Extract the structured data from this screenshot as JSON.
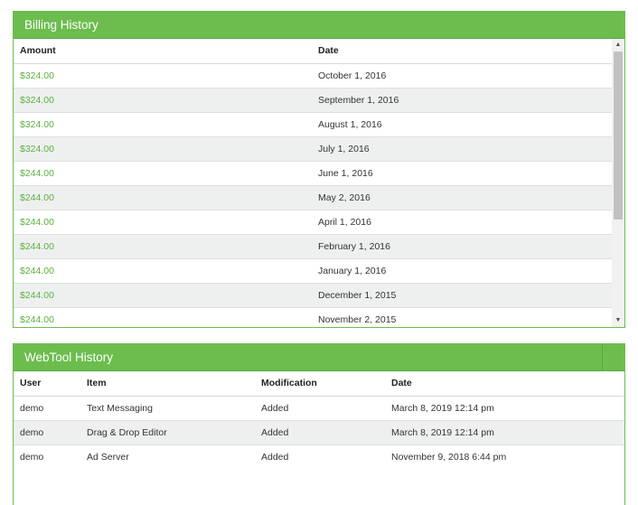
{
  "billing": {
    "title": "Billing History",
    "headers": {
      "amount": "Amount",
      "date": "Date"
    },
    "rows": [
      {
        "amount": "$324.00",
        "date": "October 1, 2016"
      },
      {
        "amount": "$324.00",
        "date": "September 1, 2016"
      },
      {
        "amount": "$324.00",
        "date": "August 1, 2016"
      },
      {
        "amount": "$324.00",
        "date": "July 1, 2016"
      },
      {
        "amount": "$244.00",
        "date": "June 1, 2016"
      },
      {
        "amount": "$244.00",
        "date": "May 2, 2016"
      },
      {
        "amount": "$244.00",
        "date": "April 1, 2016"
      },
      {
        "amount": "$244.00",
        "date": "February 1, 2016"
      },
      {
        "amount": "$244.00",
        "date": "January 1, 2016"
      },
      {
        "amount": "$244.00",
        "date": "December 1, 2015"
      },
      {
        "amount": "$244.00",
        "date": "November 2, 2015"
      }
    ]
  },
  "webtool": {
    "title": "WebTool History",
    "headers": {
      "user": "User",
      "item": "Item",
      "modification": "Modification",
      "date": "Date"
    },
    "rows": [
      {
        "user": "demo",
        "item": "Text Messaging",
        "modification": "Added",
        "date": "March 8, 2019 12:14 pm"
      },
      {
        "user": "demo",
        "item": "Drag & Drop Editor",
        "modification": "Added",
        "date": "March 8, 2019 12:14 pm"
      },
      {
        "user": "demo",
        "item": "Ad Server",
        "modification": "Added",
        "date": "November 9, 2018 6:44 pm"
      }
    ]
  },
  "icons": {
    "scroll_up": "triangle-up-icon",
    "scroll_down": "triangle-down-icon"
  },
  "colors": {
    "panel_green": "#6cbd4e",
    "amount_green": "#5cb13f",
    "row_alt": "#eef0f0"
  }
}
